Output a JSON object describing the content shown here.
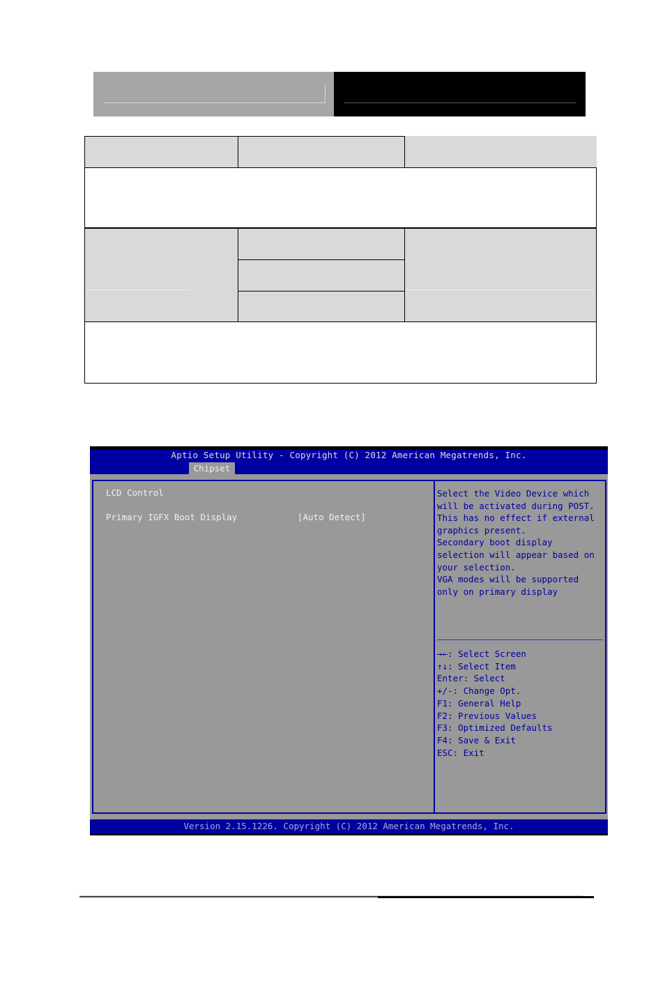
{
  "bios": {
    "title": "Aptio Setup Utility - Copyright (C) 2012 American Megatrends, Inc.",
    "active_tab": "Chipset",
    "section_heading": "LCD Control",
    "settings": [
      {
        "label": "Primary IGFX Boot Display",
        "value": "[Auto Detect]"
      }
    ],
    "help_text": [
      "Select the Video Device which",
      "will be activated during POST.",
      "This has no effect if external",
      "graphics present.",
      "Secondary boot display",
      "selection will appear based on",
      "your selection.",
      "VGA modes will be supported",
      "only on primary display"
    ],
    "key_legend": [
      "→←: Select Screen",
      "↑↓: Select Item",
      "Enter: Select",
      "+/-: Change Opt.",
      "F1: General Help",
      "F2: Previous Values",
      "F3: Optimized Defaults",
      "F4: Save & Exit",
      "ESC: Exit"
    ],
    "footer": "Version 2.15.1226. Copyright (C) 2012 American Megatrends, Inc.",
    "colors": {
      "header_bg": "#0000a0",
      "body_bg": "#999999",
      "help_text": "#0000a0",
      "item_text": "#f0f0f0"
    }
  }
}
